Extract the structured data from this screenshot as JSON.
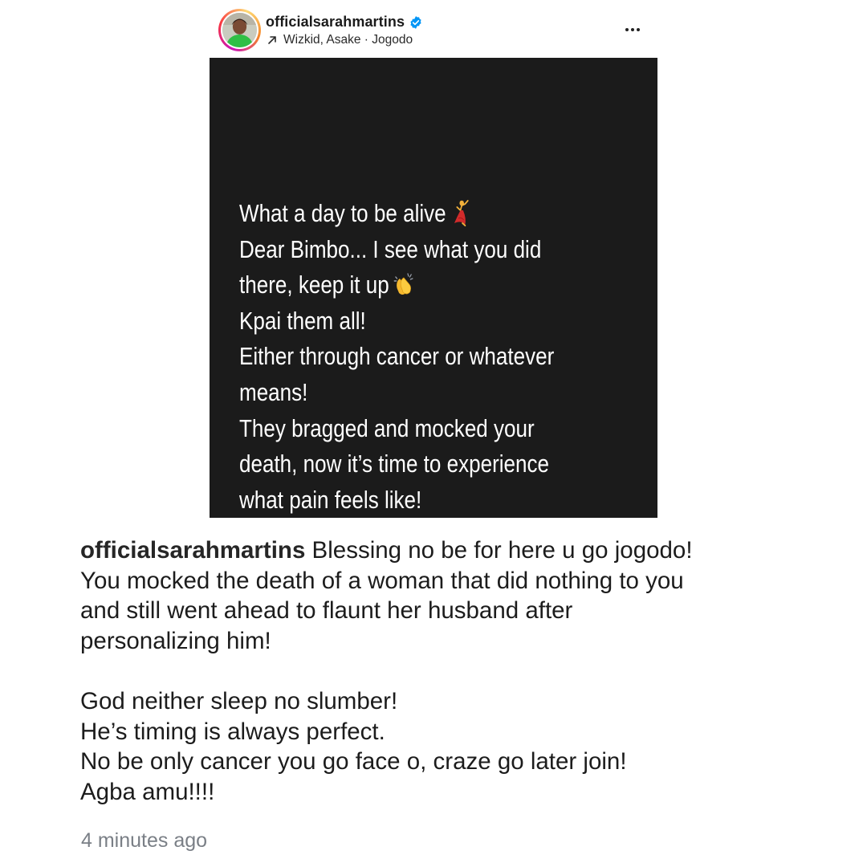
{
  "header": {
    "username": "officialsarahmartins",
    "music": "Wizkid, Asake · Jogodo"
  },
  "icons": {
    "avatar": "profile-avatar",
    "verified": "verified-badge-icon",
    "music_arrow": "arrow-up-right-icon",
    "more": "more-horizontal-icon",
    "dancer_emoji": "woman-dancing-emoji",
    "clap_emoji": "clapping-hands-emoji"
  },
  "colors": {
    "verified_blue": "#0095f6",
    "story_background": "#1b1b1b",
    "timestamp_gray": "#7a7f86"
  },
  "story": {
    "lines": [
      "What a day to be alive",
      "Dear Bimbo... I see what you did",
      "there, keep it up",
      "Kpai them all!",
      "Either through cancer or whatever",
      "means!",
      "They bragged and mocked your",
      "death, now it’s time to experience",
      "what pain feels like!"
    ]
  },
  "caption": {
    "username": "officialsarahmartins",
    "first_line": " Blessing no be for here u go jogodo!",
    "paragraph1": [
      "You mocked the death of a woman that did nothing to you",
      "and still went ahead to flaunt her husband after",
      "personalizing him!"
    ],
    "paragraph2": [
      "God neither sleep no slumber!",
      "He’s timing is always perfect.",
      "No be only cancer you go face o, craze go later join!",
      "Agba amu!!!!"
    ]
  },
  "timestamp": "4 minutes ago"
}
